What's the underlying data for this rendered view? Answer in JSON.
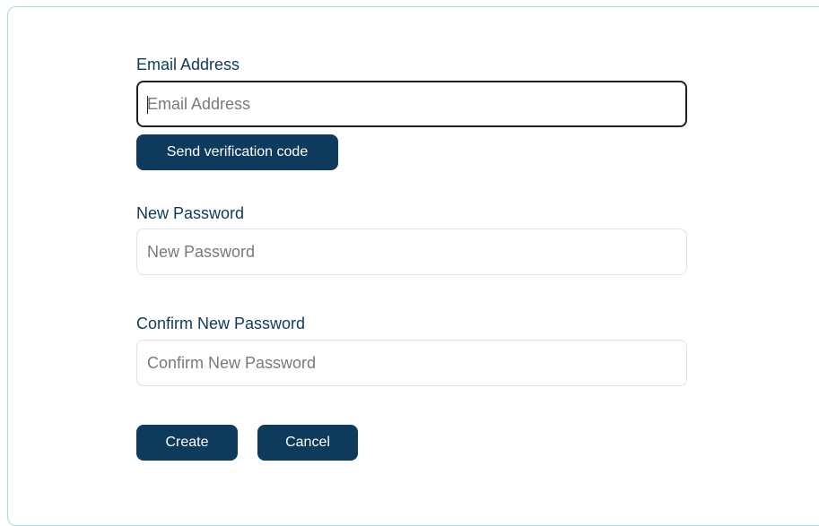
{
  "email": {
    "label": "Email Address",
    "placeholder": "Email Address",
    "value": ""
  },
  "send_code_button": "Send verification code",
  "new_password": {
    "label": "New Password",
    "placeholder": "New Password",
    "value": ""
  },
  "confirm_password": {
    "label": "Confirm New Password",
    "placeholder": "Confirm New Password",
    "value": ""
  },
  "actions": {
    "create_label": "Create",
    "cancel_label": "Cancel"
  },
  "colors": {
    "primary": "#0e3a5b",
    "card_border": "#a9dde0",
    "label_text": "#0e3a5b"
  }
}
